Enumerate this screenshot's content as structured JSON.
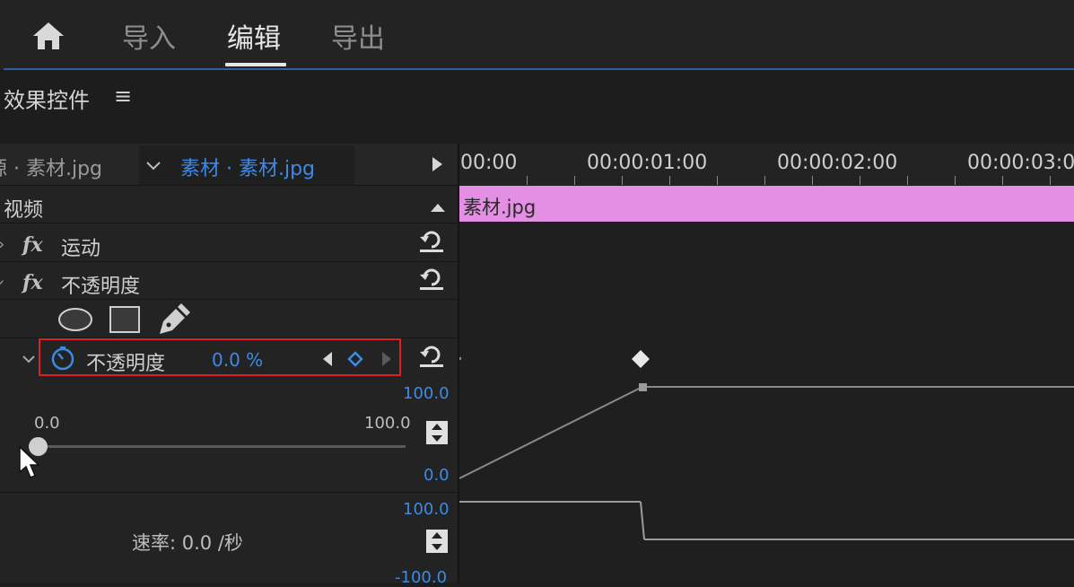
{
  "header": {
    "tabs": [
      {
        "label": "导入"
      },
      {
        "label": "编辑"
      },
      {
        "label": "导出"
      }
    ],
    "home_icon": "home-icon"
  },
  "panel": {
    "title": "效果控件",
    "menu_icon": "≡"
  },
  "clip_select": {
    "source_label": "源 · 素材.jpg",
    "current_label": "素材 · 素材.jpg"
  },
  "timeline": {
    "ticks": [
      "00:00",
      "00:00:01:00",
      "00:00:02:00",
      "00:00:03:00"
    ],
    "clip_name": "素材.jpg",
    "clip_color": "#e38fe3"
  },
  "effects": {
    "video_label": "视频",
    "motion": {
      "fx": "fx",
      "label": "运动"
    },
    "opacity": {
      "fx": "fx",
      "label": "不透明度"
    },
    "opacity_param": {
      "label": "不透明度",
      "value": "0.0 %"
    }
  },
  "graph": {
    "value_max": "100.0",
    "value_min": "0.0",
    "slider_min": "0.0",
    "slider_max": "100.0",
    "slider_value": 0.0,
    "velocity_max": "100.0",
    "velocity_min": "-100.0",
    "velocity_label": "速率: 0.0 /秒"
  },
  "colors": {
    "accent_blue": "#3d8ae6",
    "highlight_red": "#e02020",
    "clip_pink": "#e38fe3"
  }
}
